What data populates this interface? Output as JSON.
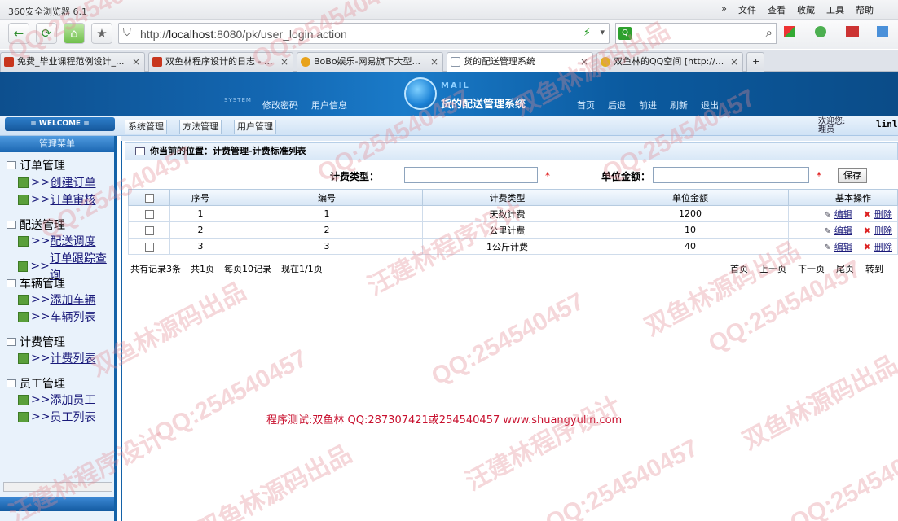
{
  "browser": {
    "title": "360安全浏览器 6.1",
    "menu": [
      "»",
      "文件",
      "查看",
      "收藏",
      "工具",
      "帮助"
    ],
    "url_host": "http://",
    "url_bold": "localhost",
    "url_rest": ":8080/pk/user_login.action",
    "tabs": [
      {
        "label": "免费_毕业课程范例设计_...",
        "color": "#c8361e"
      },
      {
        "label": "双鱼林程序设计的日志 - ...",
        "color": "#c8361e"
      },
      {
        "label": "BoBo娱乐-网易旗下大型...",
        "color": "#e8a21b"
      },
      {
        "label": "货的配送管理系统",
        "color": "#8a97a8"
      },
      {
        "label": "双鱼林的QQ空间 [http://...",
        "color": "#e0b020"
      }
    ],
    "tab_close": "×",
    "new_tab": "+"
  },
  "header": {
    "system_tag": "SYSTEM",
    "left_links": [
      "修改密码",
      "用户信息"
    ],
    "mail_tag": "MAIL",
    "app_title": "货的配送管理系统",
    "right_links": [
      "首页",
      "后退",
      "前进",
      "刷新",
      "退出"
    ]
  },
  "subbar": {
    "welcome": "= WELCOME =",
    "tabs": [
      "系统管理",
      "方法管理",
      "用户管理"
    ],
    "greeting": "欢迎您:",
    "role": "理员",
    "user": "linl"
  },
  "sidebar": {
    "title": "管理菜单",
    "groups": [
      {
        "label": "订单管理",
        "items": [
          "创建订单",
          "订单审核"
        ]
      },
      {
        "label": "配送管理",
        "items": [
          "配送调度",
          "订单跟踪查询"
        ]
      },
      {
        "label": "车辆管理",
        "items": [
          "添加车辆",
          "车辆列表"
        ]
      },
      {
        "label": "计费管理",
        "items": [
          "计费列表"
        ]
      },
      {
        "label": "员工管理",
        "items": [
          "添加员工",
          "员工列表"
        ]
      }
    ],
    "arrow": ">>"
  },
  "main": {
    "breadcrumb": "你当前的位置：计费管理-计费标准列表",
    "form": {
      "type_label": "计费类型：",
      "type_value": "",
      "amount_label": "单位金额：",
      "amount_value": "",
      "required": "*",
      "save": "保存"
    },
    "table": {
      "headers": [
        "序号",
        "编号",
        "计费类型",
        "单位金额",
        "基本操作"
      ],
      "rows": [
        {
          "seq": "1",
          "id": "1",
          "type": "天数计费",
          "amount": "1200"
        },
        {
          "seq": "2",
          "id": "2",
          "type": "公里计费",
          "amount": "10"
        },
        {
          "seq": "3",
          "id": "3",
          "type": "1公斤计费",
          "amount": "40"
        }
      ],
      "edit": "编辑",
      "delete": "删除"
    },
    "pager": {
      "total": "共有记录3条",
      "pages": "共1页",
      "per_page": "每页10记录",
      "current": "现在1/1页",
      "first": "首页",
      "prev": "上一页",
      "next": "下一页",
      "last": "尾页",
      "goto": "转到"
    },
    "footer": "程序测试:双鱼林 QQ:287307421或254540457 www.shuangyulin.com"
  },
  "watermarks": [
    "QQ:254540457",
    "双鱼林源码出品",
    "汪建林程序设计"
  ]
}
